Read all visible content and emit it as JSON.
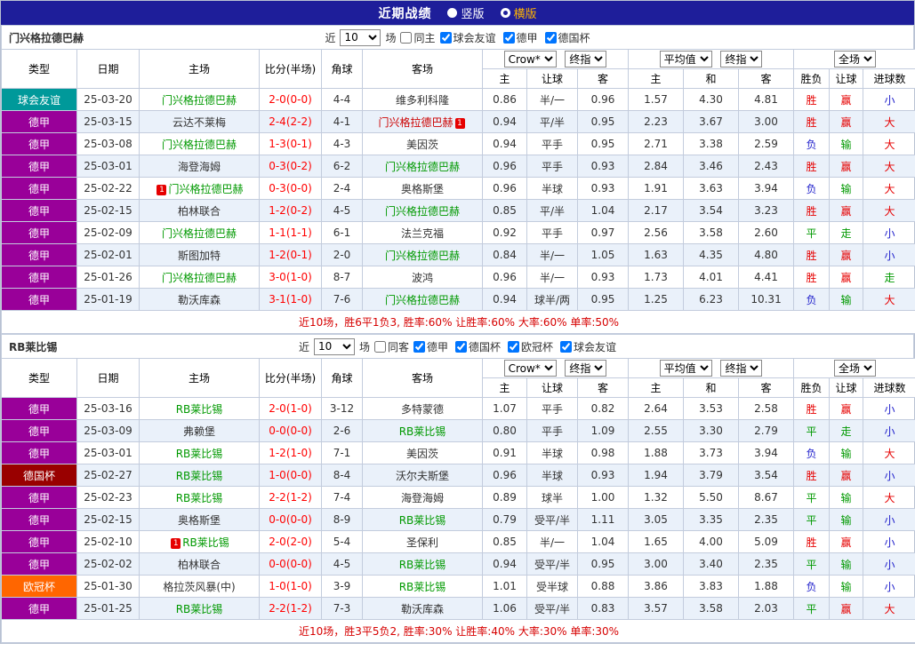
{
  "topbar": {
    "title": "近期战绩",
    "radios": [
      {
        "label": "竖版",
        "selected": false
      },
      {
        "label": "横版",
        "selected": true
      }
    ]
  },
  "table_header": {
    "cols": [
      "类型",
      "日期",
      "主场",
      "比分(半场)",
      "角球",
      "客场"
    ],
    "asia_source": "Crow*",
    "asia_time": "终指",
    "euro_source": "平均值",
    "euro_time": "终指",
    "scope": "全场",
    "sub": [
      "主",
      "让球",
      "客",
      "主",
      "和",
      "客",
      "胜负",
      "让球",
      "进球数"
    ]
  },
  "colors": {
    "topbar_bg": "#1e1e9a",
    "selected_radio": "#ffb400",
    "team_name": "#009900",
    "team_name_red": "#cc0000",
    "score": "#ff0000",
    "summary": "#d60000",
    "badge_bg": "#e60000",
    "results": {
      "red": "#e60000",
      "green": "#009900",
      "blue": "#2222cc"
    },
    "types": {
      "德甲": "#990099",
      "球会友谊": "#00999a",
      "德国杯": "#990000",
      "欧冠杯": "#ff6600"
    }
  },
  "misc": {
    "red_card_badge": "1"
  },
  "sections": [
    {
      "team": "门兴格拉德巴赫",
      "filter": {
        "near_label": "近",
        "count": "10",
        "games_label": "场",
        "same_label": "同主",
        "same_checked": false,
        "leagues": [
          {
            "label": "球会友谊",
            "checked": true
          },
          {
            "label": "德甲",
            "checked": true
          },
          {
            "label": "德国杯",
            "checked": true
          }
        ]
      },
      "rows": [
        {
          "type": "球会友谊",
          "date": "25-03-20",
          "home": "门兴格拉德巴赫",
          "home_mark": "team",
          "home_badge": false,
          "score": "2-0(0-0)",
          "corner": "4-4",
          "away": "维多利科隆",
          "away_mark": "",
          "away_badge": false,
          "asia": [
            "0.86",
            "半/一",
            "0.96"
          ],
          "euro": [
            "1.57",
            "4.30",
            "4.81"
          ],
          "results": [
            [
              "胜",
              "red"
            ],
            [
              "赢",
              "red"
            ],
            [
              "小",
              "blue"
            ]
          ]
        },
        {
          "type": "德甲",
          "date": "25-03-15",
          "home": "云达不莱梅",
          "home_mark": "",
          "home_badge": false,
          "score": "2-4(2-2)",
          "corner": "4-1",
          "away": "门兴格拉德巴赫",
          "away_mark": "team-red",
          "away_badge": true,
          "asia": [
            "0.94",
            "平/半",
            "0.95"
          ],
          "euro": [
            "2.23",
            "3.67",
            "3.00"
          ],
          "results": [
            [
              "胜",
              "red"
            ],
            [
              "赢",
              "red"
            ],
            [
              "大",
              "red"
            ]
          ]
        },
        {
          "type": "德甲",
          "date": "25-03-08",
          "home": "门兴格拉德巴赫",
          "home_mark": "team",
          "home_badge": false,
          "score": "1-3(0-1)",
          "corner": "4-3",
          "away": "美因茨",
          "away_mark": "",
          "away_badge": false,
          "asia": [
            "0.94",
            "平手",
            "0.95"
          ],
          "euro": [
            "2.71",
            "3.38",
            "2.59"
          ],
          "results": [
            [
              "负",
              "blue"
            ],
            [
              "输",
              "green"
            ],
            [
              "大",
              "red"
            ]
          ]
        },
        {
          "type": "德甲",
          "date": "25-03-01",
          "home": "海登海姆",
          "home_mark": "",
          "home_badge": false,
          "score": "0-3(0-2)",
          "corner": "6-2",
          "away": "门兴格拉德巴赫",
          "away_mark": "team",
          "away_badge": false,
          "asia": [
            "0.96",
            "平手",
            "0.93"
          ],
          "euro": [
            "2.84",
            "3.46",
            "2.43"
          ],
          "results": [
            [
              "胜",
              "red"
            ],
            [
              "赢",
              "red"
            ],
            [
              "大",
              "red"
            ]
          ]
        },
        {
          "type": "德甲",
          "date": "25-02-22",
          "home": "门兴格拉德巴赫",
          "home_mark": "team",
          "home_badge": true,
          "score": "0-3(0-0)",
          "corner": "2-4",
          "away": "奥格斯堡",
          "away_mark": "",
          "away_badge": false,
          "asia": [
            "0.96",
            "半球",
            "0.93"
          ],
          "euro": [
            "1.91",
            "3.63",
            "3.94"
          ],
          "results": [
            [
              "负",
              "blue"
            ],
            [
              "输",
              "green"
            ],
            [
              "大",
              "red"
            ]
          ]
        },
        {
          "type": "德甲",
          "date": "25-02-15",
          "home": "柏林联合",
          "home_mark": "",
          "home_badge": false,
          "score": "1-2(0-2)",
          "corner": "4-5",
          "away": "门兴格拉德巴赫",
          "away_mark": "team",
          "away_badge": false,
          "asia": [
            "0.85",
            "平/半",
            "1.04"
          ],
          "euro": [
            "2.17",
            "3.54",
            "3.23"
          ],
          "results": [
            [
              "胜",
              "red"
            ],
            [
              "赢",
              "red"
            ],
            [
              "大",
              "red"
            ]
          ]
        },
        {
          "type": "德甲",
          "date": "25-02-09",
          "home": "门兴格拉德巴赫",
          "home_mark": "team",
          "home_badge": false,
          "score": "1-1(1-1)",
          "corner": "6-1",
          "away": "法兰克福",
          "away_mark": "",
          "away_badge": false,
          "asia": [
            "0.92",
            "平手",
            "0.97"
          ],
          "euro": [
            "2.56",
            "3.58",
            "2.60"
          ],
          "results": [
            [
              "平",
              "green"
            ],
            [
              "走",
              "green"
            ],
            [
              "小",
              "blue"
            ]
          ]
        },
        {
          "type": "德甲",
          "date": "25-02-01",
          "home": "斯图加特",
          "home_mark": "",
          "home_badge": false,
          "score": "1-2(0-1)",
          "corner": "2-0",
          "away": "门兴格拉德巴赫",
          "away_mark": "team",
          "away_badge": false,
          "asia": [
            "0.84",
            "半/一",
            "1.05"
          ],
          "euro": [
            "1.63",
            "4.35",
            "4.80"
          ],
          "results": [
            [
              "胜",
              "red"
            ],
            [
              "赢",
              "red"
            ],
            [
              "小",
              "blue"
            ]
          ]
        },
        {
          "type": "德甲",
          "date": "25-01-26",
          "home": "门兴格拉德巴赫",
          "home_mark": "team",
          "home_badge": false,
          "score": "3-0(1-0)",
          "corner": "8-7",
          "away": "波鸿",
          "away_mark": "",
          "away_badge": false,
          "asia": [
            "0.96",
            "半/一",
            "0.93"
          ],
          "euro": [
            "1.73",
            "4.01",
            "4.41"
          ],
          "results": [
            [
              "胜",
              "red"
            ],
            [
              "赢",
              "red"
            ],
            [
              "走",
              "green"
            ]
          ]
        },
        {
          "type": "德甲",
          "date": "25-01-19",
          "home": "勒沃库森",
          "home_mark": "",
          "home_badge": false,
          "score": "3-1(1-0)",
          "corner": "7-6",
          "away": "门兴格拉德巴赫",
          "away_mark": "team",
          "away_badge": false,
          "asia": [
            "0.94",
            "球半/两",
            "0.95"
          ],
          "euro": [
            "1.25",
            "6.23",
            "10.31"
          ],
          "results": [
            [
              "负",
              "blue"
            ],
            [
              "输",
              "green"
            ],
            [
              "大",
              "red"
            ]
          ]
        }
      ],
      "summary": "近10场，胜6平1负3, 胜率:60% 让胜率:60% 大率:60% 单率:50%"
    },
    {
      "team": "RB莱比锡",
      "filter": {
        "near_label": "近",
        "count": "10",
        "games_label": "场",
        "same_label": "同客",
        "same_checked": false,
        "leagues": [
          {
            "label": "德甲",
            "checked": true
          },
          {
            "label": "德国杯",
            "checked": true
          },
          {
            "label": "欧冠杯",
            "checked": true
          },
          {
            "label": "球会友谊",
            "checked": true
          }
        ]
      },
      "rows": [
        {
          "type": "德甲",
          "date": "25-03-16",
          "home": "RB莱比锡",
          "home_mark": "team",
          "home_badge": false,
          "score": "2-0(1-0)",
          "corner": "3-12",
          "away": "多特蒙德",
          "away_mark": "",
          "away_badge": false,
          "asia": [
            "1.07",
            "平手",
            "0.82"
          ],
          "euro": [
            "2.64",
            "3.53",
            "2.58"
          ],
          "results": [
            [
              "胜",
              "red"
            ],
            [
              "赢",
              "red"
            ],
            [
              "小",
              "blue"
            ]
          ]
        },
        {
          "type": "德甲",
          "date": "25-03-09",
          "home": "弗赖堡",
          "home_mark": "",
          "home_badge": false,
          "score": "0-0(0-0)",
          "corner": "2-6",
          "away": "RB莱比锡",
          "away_mark": "team",
          "away_badge": false,
          "asia": [
            "0.80",
            "平手",
            "1.09"
          ],
          "euro": [
            "2.55",
            "3.30",
            "2.79"
          ],
          "results": [
            [
              "平",
              "green"
            ],
            [
              "走",
              "green"
            ],
            [
              "小",
              "blue"
            ]
          ]
        },
        {
          "type": "德甲",
          "date": "25-03-01",
          "home": "RB莱比锡",
          "home_mark": "team",
          "home_badge": false,
          "score": "1-2(1-0)",
          "corner": "7-1",
          "away": "美因茨",
          "away_mark": "",
          "away_badge": false,
          "asia": [
            "0.91",
            "半球",
            "0.98"
          ],
          "euro": [
            "1.88",
            "3.73",
            "3.94"
          ],
          "results": [
            [
              "负",
              "blue"
            ],
            [
              "输",
              "green"
            ],
            [
              "大",
              "red"
            ]
          ]
        },
        {
          "type": "德国杯",
          "date": "25-02-27",
          "home": "RB莱比锡",
          "home_mark": "team",
          "home_badge": false,
          "score": "1-0(0-0)",
          "corner": "8-4",
          "away": "沃尔夫斯堡",
          "away_mark": "",
          "away_badge": false,
          "asia": [
            "0.96",
            "半球",
            "0.93"
          ],
          "euro": [
            "1.94",
            "3.79",
            "3.54"
          ],
          "results": [
            [
              "胜",
              "red"
            ],
            [
              "赢",
              "red"
            ],
            [
              "小",
              "blue"
            ]
          ]
        },
        {
          "type": "德甲",
          "date": "25-02-23",
          "home": "RB莱比锡",
          "home_mark": "team",
          "home_badge": false,
          "score": "2-2(1-2)",
          "corner": "7-4",
          "away": "海登海姆",
          "away_mark": "",
          "away_badge": false,
          "asia": [
            "0.89",
            "球半",
            "1.00"
          ],
          "euro": [
            "1.32",
            "5.50",
            "8.67"
          ],
          "results": [
            [
              "平",
              "green"
            ],
            [
              "输",
              "green"
            ],
            [
              "大",
              "red"
            ]
          ]
        },
        {
          "type": "德甲",
          "date": "25-02-15",
          "home": "奥格斯堡",
          "home_mark": "",
          "home_badge": false,
          "score": "0-0(0-0)",
          "corner": "8-9",
          "away": "RB莱比锡",
          "away_mark": "team",
          "away_badge": false,
          "asia": [
            "0.79",
            "受平/半",
            "1.11"
          ],
          "euro": [
            "3.05",
            "3.35",
            "2.35"
          ],
          "results": [
            [
              "平",
              "green"
            ],
            [
              "输",
              "green"
            ],
            [
              "小",
              "blue"
            ]
          ]
        },
        {
          "type": "德甲",
          "date": "25-02-10",
          "home": "RB莱比锡",
          "home_mark": "team",
          "home_badge": true,
          "score": "2-0(2-0)",
          "corner": "5-4",
          "away": "圣保利",
          "away_mark": "",
          "away_badge": false,
          "asia": [
            "0.85",
            "半/一",
            "1.04"
          ],
          "euro": [
            "1.65",
            "4.00",
            "5.09"
          ],
          "results": [
            [
              "胜",
              "red"
            ],
            [
              "赢",
              "red"
            ],
            [
              "小",
              "blue"
            ]
          ]
        },
        {
          "type": "德甲",
          "date": "25-02-02",
          "home": "柏林联合",
          "home_mark": "",
          "home_badge": false,
          "score": "0-0(0-0)",
          "corner": "4-5",
          "away": "RB莱比锡",
          "away_mark": "team",
          "away_badge": false,
          "asia": [
            "0.94",
            "受平/半",
            "0.95"
          ],
          "euro": [
            "3.00",
            "3.40",
            "2.35"
          ],
          "results": [
            [
              "平",
              "green"
            ],
            [
              "输",
              "green"
            ],
            [
              "小",
              "blue"
            ]
          ]
        },
        {
          "type": "欧冠杯",
          "date": "25-01-30",
          "home": "格拉茨风暴(中)",
          "home_mark": "",
          "home_badge": false,
          "score": "1-0(1-0)",
          "corner": "3-9",
          "away": "RB莱比锡",
          "away_mark": "team",
          "away_badge": false,
          "asia": [
            "1.01",
            "受半球",
            "0.88"
          ],
          "euro": [
            "3.86",
            "3.83",
            "1.88"
          ],
          "results": [
            [
              "负",
              "blue"
            ],
            [
              "输",
              "green"
            ],
            [
              "小",
              "blue"
            ]
          ]
        },
        {
          "type": "德甲",
          "date": "25-01-25",
          "home": "RB莱比锡",
          "home_mark": "team",
          "home_badge": false,
          "score": "2-2(1-2)",
          "corner": "7-3",
          "away": "勒沃库森",
          "away_mark": "",
          "away_badge": false,
          "asia": [
            "1.06",
            "受平/半",
            "0.83"
          ],
          "euro": [
            "3.57",
            "3.58",
            "2.03"
          ],
          "results": [
            [
              "平",
              "green"
            ],
            [
              "赢",
              "red"
            ],
            [
              "大",
              "red"
            ]
          ]
        }
      ],
      "summary": "近10场，胜3平5负2, 胜率:30% 让胜率:40% 大率:30% 单率:30%"
    }
  ]
}
